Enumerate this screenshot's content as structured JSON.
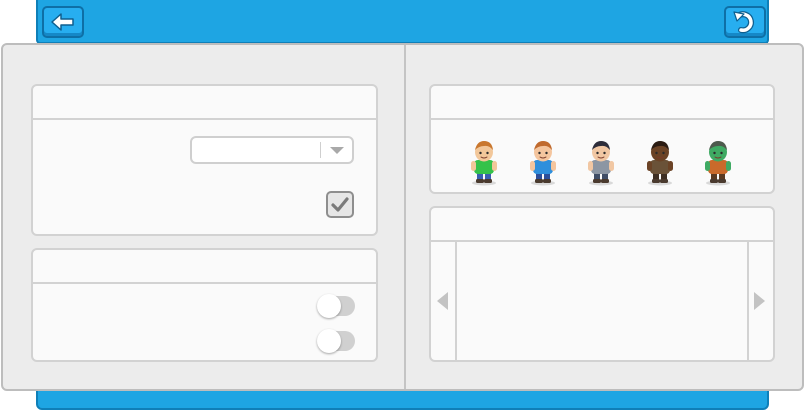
{
  "topbar": {
    "back_icon": "arrow-left-icon",
    "undo_icon": "undo-icon"
  },
  "settings_panel": {
    "title": "",
    "dropdown": {
      "selected": ""
    },
    "checkbox": {
      "checked": true
    }
  },
  "toggles_panel": {
    "title": "",
    "toggles": [
      {
        "on": false
      },
      {
        "on": false
      }
    ]
  },
  "characters_panel": {
    "title": "",
    "characters": [
      {
        "name": "boy-green-shirt",
        "skin": "#f2c79a",
        "hair": "#c9772e",
        "top": "#35c24a",
        "pants": "#3a5fb0"
      },
      {
        "name": "girl-blue-shirt",
        "skin": "#f4c59e",
        "hair": "#c06a2e",
        "top": "#2f8fdc",
        "pants": "#2d4f9a"
      },
      {
        "name": "man-gray-shirt",
        "skin": "#f1c7a3",
        "hair": "#2d2d3a",
        "top": "#8c96a3",
        "pants": "#3f4d66"
      },
      {
        "name": "man-brown-outfit",
        "skin": "#6b4326",
        "hair": "#2a1b12",
        "top": "#6a5238",
        "pants": "#3d2e22"
      },
      {
        "name": "green-creature",
        "skin": "#3faa63",
        "hair": "#4d5a4d",
        "top": "#c96a2b",
        "pants": "#5a3a22"
      }
    ]
  },
  "preview_panel": {
    "title": "",
    "prev_icon": "chevron-left-icon",
    "next_icon": "chevron-right-icon"
  },
  "colors": {
    "accent": "#1ea5e3",
    "accent_dark": "#0f7fb8",
    "page_bg": "#ececec"
  }
}
